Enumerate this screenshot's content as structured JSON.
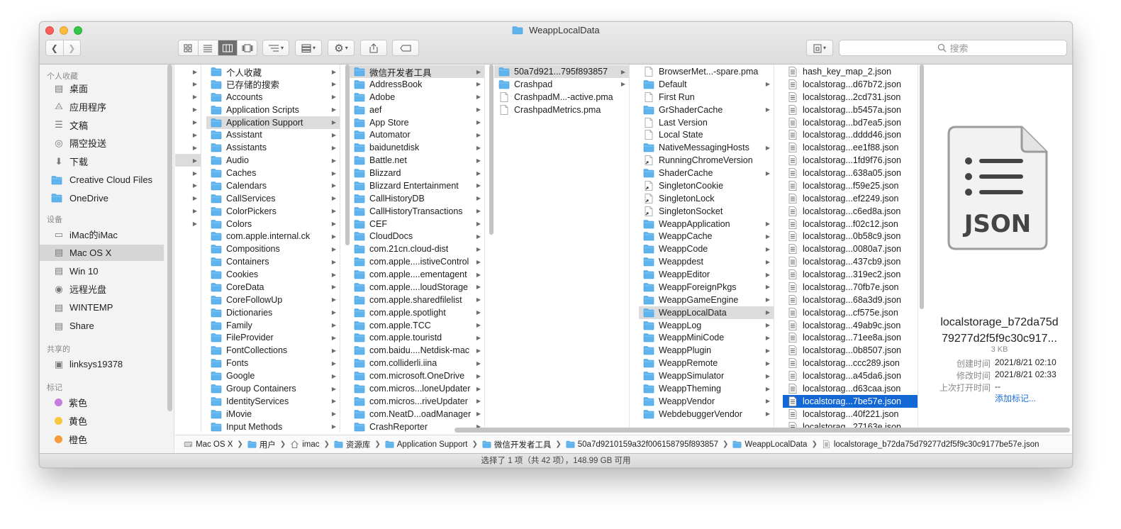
{
  "window": {
    "title": "WeappLocalData"
  },
  "toolbar": {
    "search_placeholder": "搜索"
  },
  "sidebar": {
    "sections": [
      {
        "heading": "个人收藏",
        "items": [
          {
            "label": "桌面",
            "icon": "desktop-icon"
          },
          {
            "label": "应用程序",
            "icon": "applications-icon"
          },
          {
            "label": "文稿",
            "icon": "documents-icon"
          },
          {
            "label": "隔空投送",
            "icon": "airdrop-icon"
          },
          {
            "label": "下载",
            "icon": "downloads-icon"
          },
          {
            "label": "Creative Cloud Files",
            "icon": "folder-icon"
          },
          {
            "label": "OneDrive",
            "icon": "folder-icon"
          }
        ]
      },
      {
        "heading": "设备",
        "items": [
          {
            "label": "iMac的iMac",
            "icon": "imac-icon"
          },
          {
            "label": "Mac OS X",
            "icon": "disk-icon",
            "active": true
          },
          {
            "label": "Win 10",
            "icon": "disk-icon"
          },
          {
            "label": "远程光盘",
            "icon": "disc-icon"
          },
          {
            "label": "WINTEMP",
            "icon": "disk-icon"
          },
          {
            "label": "Share",
            "icon": "disk-icon"
          }
        ]
      },
      {
        "heading": "共享的",
        "items": [
          {
            "label": "linksys19378",
            "icon": "network-computer-icon"
          }
        ]
      },
      {
        "heading": "标记",
        "items": [
          {
            "label": "紫色",
            "tag_color": "#c37ede"
          },
          {
            "label": "黄色",
            "tag_color": "#f6c93c"
          },
          {
            "label": "橙色",
            "tag_color": "#f79a3b"
          }
        ]
      }
    ]
  },
  "columns": [
    {
      "items": [
        {
          "type": "none",
          "arrow": true
        },
        {
          "type": "none",
          "arrow": true
        },
        {
          "type": "none",
          "arrow": true
        },
        {
          "type": "none",
          "arrow": true
        },
        {
          "type": "none",
          "arrow": true
        },
        {
          "type": "none",
          "arrow": true
        },
        {
          "type": "none",
          "arrow": true
        },
        {
          "type": "none",
          "arrow": true,
          "sel": "grey"
        },
        {
          "type": "none",
          "arrow": true
        },
        {
          "type": "none",
          "arrow": true
        },
        {
          "type": "none",
          "arrow": true
        },
        {
          "type": "none",
          "arrow": true
        },
        {
          "type": "none",
          "arrow": true
        }
      ]
    },
    {
      "items": [
        {
          "name": "个人收藏",
          "type": "folder",
          "arrow": true
        },
        {
          "name": "已存储的搜索",
          "type": "folder",
          "arrow": true
        },
        {
          "name": "Accounts",
          "type": "folder",
          "arrow": true
        },
        {
          "name": "Application Scripts",
          "type": "folder",
          "arrow": true
        },
        {
          "name": "Application Support",
          "type": "folder",
          "arrow": true,
          "sel": "grey"
        },
        {
          "name": "Assistant",
          "type": "folder",
          "arrow": true
        },
        {
          "name": "Assistants",
          "type": "folder",
          "arrow": true
        },
        {
          "name": "Audio",
          "type": "folder",
          "arrow": true
        },
        {
          "name": "Caches",
          "type": "folder",
          "arrow": true
        },
        {
          "name": "Calendars",
          "type": "folder",
          "arrow": true
        },
        {
          "name": "CallServices",
          "type": "folder",
          "arrow": true
        },
        {
          "name": "ColorPickers",
          "type": "folder",
          "arrow": true
        },
        {
          "name": "Colors",
          "type": "folder",
          "arrow": true
        },
        {
          "name": "com.apple.internal.ck",
          "type": "folder",
          "arrow": true
        },
        {
          "name": "Compositions",
          "type": "folder",
          "arrow": true
        },
        {
          "name": "Containers",
          "type": "folder",
          "arrow": true
        },
        {
          "name": "Cookies",
          "type": "folder",
          "arrow": true
        },
        {
          "name": "CoreData",
          "type": "folder",
          "arrow": true
        },
        {
          "name": "CoreFollowUp",
          "type": "folder",
          "arrow": true
        },
        {
          "name": "Dictionaries",
          "type": "folder",
          "arrow": true
        },
        {
          "name": "Family",
          "type": "folder",
          "arrow": true
        },
        {
          "name": "FileProvider",
          "type": "folder",
          "arrow": true
        },
        {
          "name": "FontCollections",
          "type": "folder",
          "arrow": true
        },
        {
          "name": "Fonts",
          "type": "folder",
          "arrow": true
        },
        {
          "name": "Google",
          "type": "folder",
          "arrow": true
        },
        {
          "name": "Group Containers",
          "type": "folder",
          "arrow": true
        },
        {
          "name": "IdentityServices",
          "type": "folder",
          "arrow": true
        },
        {
          "name": "iMovie",
          "type": "folder",
          "arrow": true
        },
        {
          "name": "Input Methods",
          "type": "folder",
          "arrow": true
        }
      ]
    },
    {
      "items": [
        {
          "name": "微信开发者工具",
          "type": "folder",
          "arrow": true,
          "sel": "grey"
        },
        {
          "name": "AddressBook",
          "type": "folder",
          "arrow": true
        },
        {
          "name": "Adobe",
          "type": "folder",
          "arrow": true
        },
        {
          "name": "aef",
          "type": "folder",
          "arrow": true
        },
        {
          "name": "App Store",
          "type": "folder",
          "arrow": true
        },
        {
          "name": "Automator",
          "type": "folder",
          "arrow": true
        },
        {
          "name": "baidunetdisk",
          "type": "folder",
          "arrow": true
        },
        {
          "name": "Battle.net",
          "type": "folder",
          "arrow": true
        },
        {
          "name": "Blizzard",
          "type": "folder",
          "arrow": true
        },
        {
          "name": "Blizzard Entertainment",
          "type": "folder",
          "arrow": true
        },
        {
          "name": "CallHistoryDB",
          "type": "folder",
          "arrow": true
        },
        {
          "name": "CallHistoryTransactions",
          "type": "folder",
          "arrow": true
        },
        {
          "name": "CEF",
          "type": "folder",
          "arrow": true
        },
        {
          "name": "CloudDocs",
          "type": "folder",
          "arrow": true
        },
        {
          "name": "com.21cn.cloud-dist",
          "type": "folder",
          "arrow": true
        },
        {
          "name": "com.apple....istiveControl",
          "type": "folder",
          "arrow": true
        },
        {
          "name": "com.apple....ementagent",
          "type": "folder",
          "arrow": true
        },
        {
          "name": "com.apple....loudStorage",
          "type": "folder",
          "arrow": true
        },
        {
          "name": "com.apple.sharedfilelist",
          "type": "folder",
          "arrow": true
        },
        {
          "name": "com.apple.spotlight",
          "type": "folder",
          "arrow": true
        },
        {
          "name": "com.apple.TCC",
          "type": "folder",
          "arrow": true
        },
        {
          "name": "com.apple.touristd",
          "type": "folder",
          "arrow": true
        },
        {
          "name": "com.baidu....Netdisk-mac",
          "type": "folder",
          "arrow": true
        },
        {
          "name": "com.colliderli.iina",
          "type": "folder",
          "arrow": true
        },
        {
          "name": "com.microsoft.OneDrive",
          "type": "folder",
          "arrow": true
        },
        {
          "name": "com.micros...loneUpdater",
          "type": "folder",
          "arrow": true
        },
        {
          "name": "com.micros...riveUpdater",
          "type": "folder",
          "arrow": true
        },
        {
          "name": "com.NeatD...oadManager",
          "type": "folder",
          "arrow": true
        },
        {
          "name": "CrashReporter",
          "type": "folder",
          "arrow": true
        }
      ]
    },
    {
      "items": [
        {
          "name": "50a7d921...795f893857",
          "type": "folder",
          "arrow": true,
          "sel": "grey"
        },
        {
          "name": "Crashpad",
          "type": "folder",
          "arrow": true
        },
        {
          "name": "CrashpadM...-active.pma",
          "type": "doc",
          "arrow": false
        },
        {
          "name": "CrashpadMetrics.pma",
          "type": "doc",
          "arrow": false
        }
      ]
    },
    {
      "items": [
        {
          "name": "BrowserMet...-spare.pma",
          "type": "doc",
          "arrow": false
        },
        {
          "name": "Default",
          "type": "folder",
          "arrow": true
        },
        {
          "name": "First Run",
          "type": "doc",
          "arrow": false
        },
        {
          "name": "GrShaderCache",
          "type": "folder",
          "arrow": true
        },
        {
          "name": "Last Version",
          "type": "doc",
          "arrow": false
        },
        {
          "name": "Local State",
          "type": "doc",
          "arrow": false
        },
        {
          "name": "NativeMessagingHosts",
          "type": "folder",
          "arrow": true
        },
        {
          "name": "RunningChromeVersion",
          "type": "alias",
          "arrow": false
        },
        {
          "name": "ShaderCache",
          "type": "folder",
          "arrow": true
        },
        {
          "name": "SingletonCookie",
          "type": "alias",
          "arrow": false
        },
        {
          "name": "SingletonLock",
          "type": "alias",
          "arrow": false
        },
        {
          "name": "SingletonSocket",
          "type": "alias",
          "arrow": false
        },
        {
          "name": "WeappApplication",
          "type": "folder",
          "arrow": true
        },
        {
          "name": "WeappCache",
          "type": "folder",
          "arrow": true
        },
        {
          "name": "WeappCode",
          "type": "folder",
          "arrow": true
        },
        {
          "name": "Weappdest",
          "type": "folder",
          "arrow": true
        },
        {
          "name": "WeappEditor",
          "type": "folder",
          "arrow": true
        },
        {
          "name": "WeappForeignPkgs",
          "type": "folder",
          "arrow": true
        },
        {
          "name": "WeappGameEngine",
          "type": "folder",
          "arrow": true
        },
        {
          "name": "WeappLocalData",
          "type": "folder",
          "arrow": true,
          "sel": "grey"
        },
        {
          "name": "WeappLog",
          "type": "folder",
          "arrow": true
        },
        {
          "name": "WeappMiniCode",
          "type": "folder",
          "arrow": true
        },
        {
          "name": "WeappPlugin",
          "type": "folder",
          "arrow": true
        },
        {
          "name": "WeappRemote",
          "type": "folder",
          "arrow": true
        },
        {
          "name": "WeappSimulator",
          "type": "folder",
          "arrow": true
        },
        {
          "name": "WeappTheming",
          "type": "folder",
          "arrow": true
        },
        {
          "name": "WeappVendor",
          "type": "folder",
          "arrow": true
        },
        {
          "name": "WebdebuggerVendor",
          "type": "folder",
          "arrow": true
        }
      ]
    },
    {
      "items": [
        {
          "name": "hash_key_map_2.json",
          "type": "list",
          "arrow": false
        },
        {
          "name": "localstorag...d67b72.json",
          "type": "list",
          "arrow": false
        },
        {
          "name": "localstorag...2cd731.json",
          "type": "list",
          "arrow": false
        },
        {
          "name": "localstorag...b5457a.json",
          "type": "list",
          "arrow": false
        },
        {
          "name": "localstorag...bd7ea5.json",
          "type": "list",
          "arrow": false
        },
        {
          "name": "localstorag...dddd46.json",
          "type": "list",
          "arrow": false
        },
        {
          "name": "localstorag...ee1f88.json",
          "type": "list",
          "arrow": false
        },
        {
          "name": "localstorag...1fd9f76.json",
          "type": "list",
          "arrow": false
        },
        {
          "name": "localstorag...638a05.json",
          "type": "list",
          "arrow": false
        },
        {
          "name": "localstorag...f59e25.json",
          "type": "list",
          "arrow": false
        },
        {
          "name": "localstorag...ef2249.json",
          "type": "list",
          "arrow": false
        },
        {
          "name": "localstorag...c6ed8a.json",
          "type": "list",
          "arrow": false
        },
        {
          "name": "localstorag...f02c12.json",
          "type": "list",
          "arrow": false
        },
        {
          "name": "localstorag...0b58c9.json",
          "type": "list",
          "arrow": false
        },
        {
          "name": "localstorag...0080a7.json",
          "type": "list",
          "arrow": false
        },
        {
          "name": "localstorag...437cb9.json",
          "type": "list",
          "arrow": false
        },
        {
          "name": "localstorag...319ec2.json",
          "type": "list",
          "arrow": false
        },
        {
          "name": "localstorag...70fb7e.json",
          "type": "list",
          "arrow": false
        },
        {
          "name": "localstorag...68a3d9.json",
          "type": "list",
          "arrow": false
        },
        {
          "name": "localstorag...cf575e.json",
          "type": "list",
          "arrow": false
        },
        {
          "name": "localstorag...49ab9c.json",
          "type": "list",
          "arrow": false
        },
        {
          "name": "localstorag...71ee8a.json",
          "type": "list",
          "arrow": false
        },
        {
          "name": "localstorag...0b8507.json",
          "type": "list",
          "arrow": false
        },
        {
          "name": "localstorag...ccc289.json",
          "type": "list",
          "arrow": false
        },
        {
          "name": "localstorag...a45da6.json",
          "type": "list",
          "arrow": false
        },
        {
          "name": "localstorag...d63caa.json",
          "type": "list",
          "arrow": false
        },
        {
          "name": "localstorag...7be57e.json",
          "type": "list",
          "arrow": false,
          "sel": "blue"
        },
        {
          "name": "localstorag...40f221.json",
          "type": "list",
          "arrow": false
        },
        {
          "name": "localstorag...27163e.json",
          "type": "list",
          "arrow": false
        }
      ]
    }
  ],
  "preview": {
    "badge": "JSON",
    "name_line1": "localstorage_b72da75d",
    "name_line2": "79277d2f5f9c30c917...",
    "size": "3 KB",
    "created_label": "创建时间",
    "created_value": "2021/8/21 02:10",
    "modified_label": "修改时间",
    "modified_value": "2021/8/21 02:33",
    "opened_label": "上次打开时间",
    "opened_value": "--",
    "add_tags": "添加标记..."
  },
  "pathbar": [
    {
      "label": "Mac OS X",
      "icon": "disk-icon"
    },
    {
      "label": "用户",
      "icon": "folder-icon"
    },
    {
      "label": "imac",
      "icon": "home-icon"
    },
    {
      "label": "资源库",
      "icon": "folder-icon"
    },
    {
      "label": "Application Support",
      "icon": "folder-icon"
    },
    {
      "label": "微信开发者工具",
      "icon": "folder-icon"
    },
    {
      "label": "50a7d9210159a32f006158795f893857",
      "icon": "folder-icon"
    },
    {
      "label": "WeappLocalData",
      "icon": "folder-icon"
    },
    {
      "label": "localstorage_b72da75d79277d2f5f9c30c9177be57e.json",
      "icon": "document-icon"
    }
  ],
  "status": "选择了 1 项（共 42 项），148.99 GB 可用",
  "colors": {
    "folder": "#5fb4ee",
    "selection": "#1468d6",
    "tag_purple": "#c37ede",
    "tag_yellow": "#f6c93c",
    "tag_orange": "#f79a3b"
  }
}
